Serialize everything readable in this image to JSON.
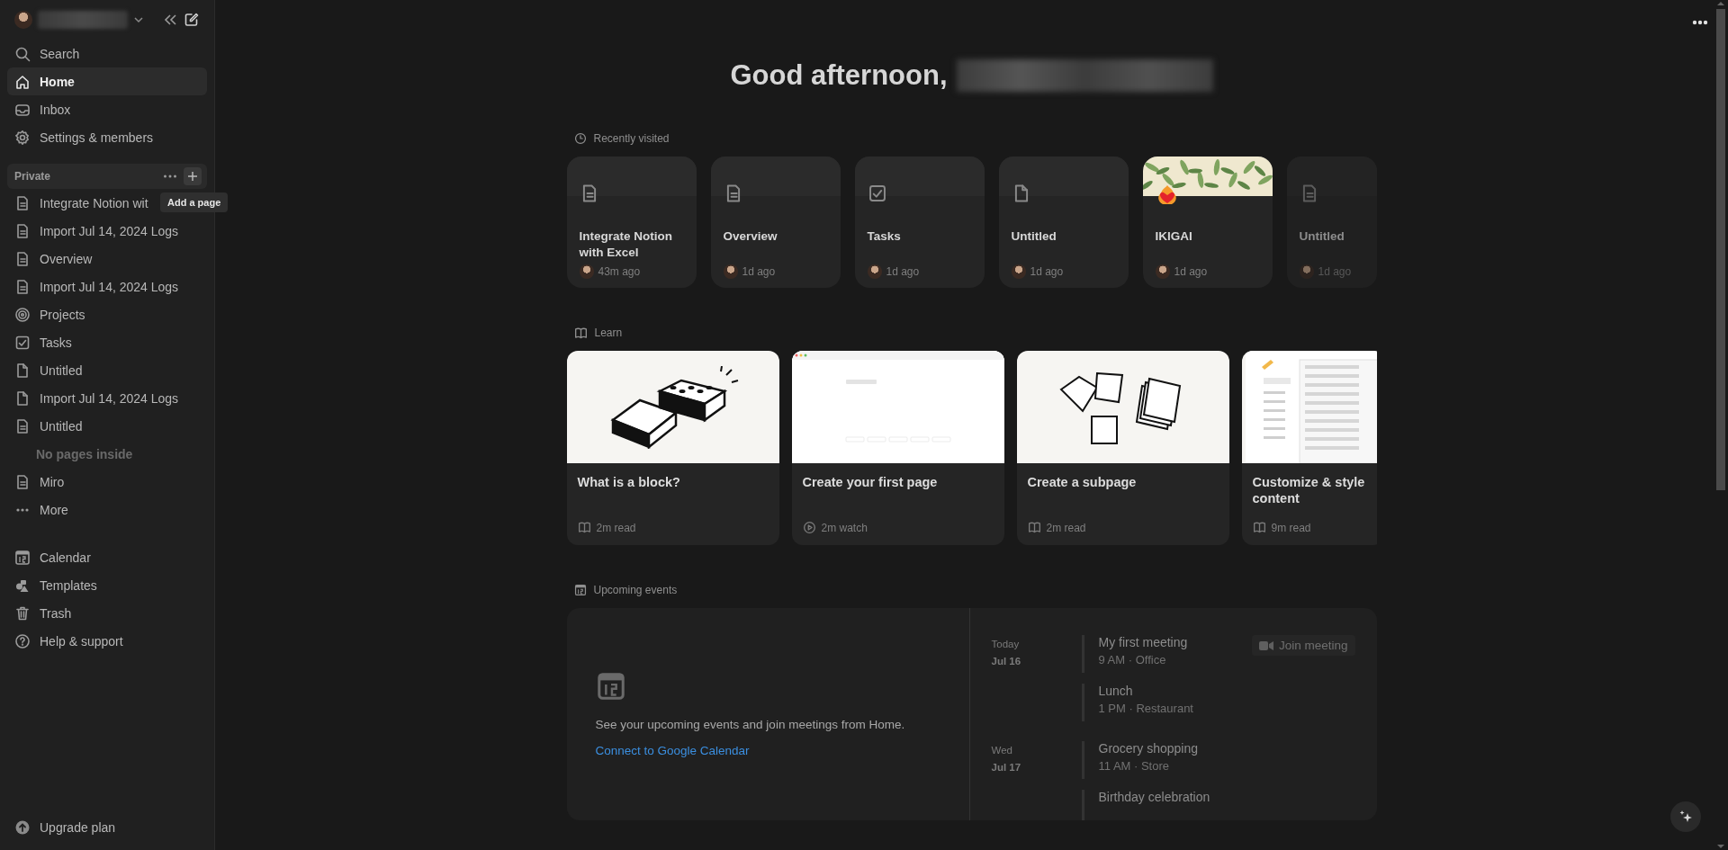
{
  "sidebar": {
    "nav": [
      {
        "label": "Search",
        "kind": "search",
        "selected": false
      },
      {
        "label": "Home",
        "kind": "home",
        "selected": true
      },
      {
        "label": "Inbox",
        "kind": "inbox",
        "selected": false
      },
      {
        "label": "Settings & members",
        "kind": "gear",
        "selected": false
      }
    ],
    "section": {
      "title": "Private",
      "tooltip": "Add a page"
    },
    "pages": [
      {
        "label": "Integrate Notion wit",
        "kind": "doc"
      },
      {
        "label": "Import Jul 14, 2024 Logs",
        "kind": "doc"
      },
      {
        "label": "Overview",
        "kind": "doc"
      },
      {
        "label": "Import Jul 14, 2024 Logs",
        "kind": "doc"
      },
      {
        "label": "Projects",
        "kind": "target"
      },
      {
        "label": "Tasks",
        "kind": "task"
      },
      {
        "label": "Untitled",
        "kind": "blank"
      },
      {
        "label": "Import Jul 14, 2024 Logs",
        "kind": "blank"
      },
      {
        "label": "Untitled",
        "kind": "doc"
      },
      {
        "label": "No pages inside",
        "kind": "empty"
      },
      {
        "label": "Miro",
        "kind": "doc"
      },
      {
        "label": "More",
        "kind": "more"
      }
    ],
    "tools": [
      {
        "label": "Calendar",
        "kind": "calendar"
      },
      {
        "label": "Templates",
        "kind": "shapes"
      },
      {
        "label": "Trash",
        "kind": "trash"
      },
      {
        "label": "Help & support",
        "kind": "help"
      }
    ],
    "footer": {
      "label": "Upgrade plan"
    }
  },
  "greeting": "Good afternoon,",
  "recently_visited": {
    "title": "Recently visited",
    "cards": [
      {
        "title": "Integrate Notion with Excel",
        "time": "43m ago",
        "kind": "doc"
      },
      {
        "title": "Overview",
        "time": "1d ago",
        "kind": "doc"
      },
      {
        "title": "Tasks",
        "time": "1d ago",
        "kind": "task"
      },
      {
        "title": "Untitled",
        "time": "1d ago",
        "kind": "blank"
      },
      {
        "title": "IKIGAI",
        "time": "1d ago",
        "kind": "cover"
      },
      {
        "title": "Untitled",
        "time": "1d ago",
        "kind": "doc"
      }
    ]
  },
  "learn": {
    "title": "Learn",
    "cards": [
      {
        "title": "What is a block?",
        "meta": {
          "text": "2m read",
          "kind": "read"
        },
        "kind": "bricks"
      },
      {
        "title": "Create your first page",
        "meta": {
          "text": "2m watch",
          "kind": "watch"
        },
        "kind": "page"
      },
      {
        "title": "Create a subpage",
        "meta": {
          "text": "2m read",
          "kind": "read"
        },
        "kind": "notes"
      },
      {
        "title": "Customize & style content",
        "meta": {
          "text": "9m read",
          "kind": "read"
        },
        "kind": "style"
      }
    ]
  },
  "upcoming": {
    "title": "Upcoming events",
    "message": "See your upcoming events and join meetings from Home.",
    "link": "Connect to Google Calendar",
    "days": [
      {
        "day": "Today",
        "date": "Jul 16",
        "events": [
          {
            "title": "My first meeting",
            "detail": "9 AM · Office",
            "action": "Join meeting"
          },
          {
            "title": "Lunch",
            "detail": "1 PM · Restaurant"
          }
        ]
      },
      {
        "day": "Wed",
        "date": "Jul 17",
        "events": [
          {
            "title": "Grocery shopping",
            "detail": "11 AM · Store"
          },
          {
            "title": "Birthday celebration"
          }
        ]
      }
    ]
  }
}
